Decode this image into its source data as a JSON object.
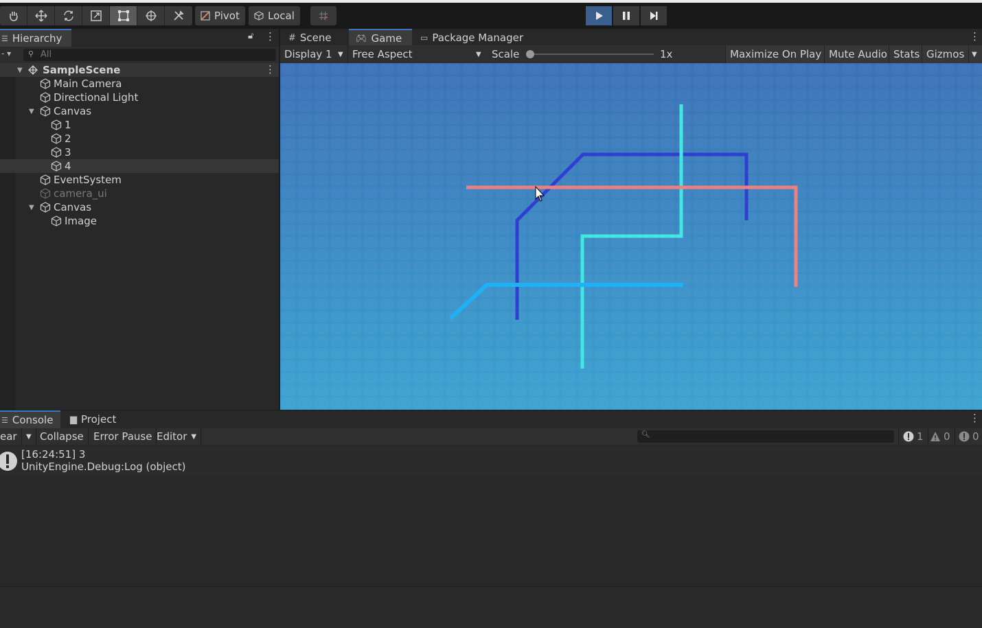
{
  "toolbar": {
    "tools": [
      "hand-icon",
      "move-icon",
      "rotate-icon",
      "scale-icon",
      "rect-icon",
      "transform-icon",
      "custom-tool-icon"
    ],
    "pivot_label": "Pivot",
    "local_label": "Local",
    "play_controls": [
      "play-icon",
      "pause-icon",
      "step-icon"
    ]
  },
  "hierarchy": {
    "tab_label": "Hierarchy",
    "search_placeholder": "All",
    "scene_name": "SampleScene",
    "items": [
      {
        "label": "Main Camera",
        "depth": 1,
        "expand": ""
      },
      {
        "label": "Directional Light",
        "depth": 1,
        "expand": ""
      },
      {
        "label": "Canvas",
        "depth": 1,
        "expand": "expanded"
      },
      {
        "label": "1",
        "depth": 2,
        "expand": ""
      },
      {
        "label": "2",
        "depth": 2,
        "expand": ""
      },
      {
        "label": "3",
        "depth": 2,
        "expand": ""
      },
      {
        "label": "4",
        "depth": 2,
        "expand": "",
        "selected": true
      },
      {
        "label": "EventSystem",
        "depth": 1,
        "expand": ""
      },
      {
        "label": "camera_ui",
        "depth": 1,
        "expand": "",
        "disabled": true
      },
      {
        "label": "Canvas",
        "depth": 1,
        "expand": "expanded"
      },
      {
        "label": "Image",
        "depth": 2,
        "expand": ""
      }
    ]
  },
  "viewtabs": {
    "scene": "Scene",
    "game": "Game",
    "package_manager": "Package Manager"
  },
  "gameview": {
    "display": "Display 1",
    "aspect": "Free Aspect",
    "scale_label": "Scale",
    "scale_value": "1x",
    "maximize": "Maximize On Play",
    "mute": "Mute Audio",
    "stats": "Stats",
    "gizmos": "Gizmos",
    "colors": {
      "line_pink": "#ef8080",
      "line_navy": "#2f3fd0",
      "line_cyan": "#40e8e0",
      "line_sky": "#20b0f5"
    }
  },
  "console": {
    "tab_console": "Console",
    "tab_project": "Project",
    "clear_label": "ear",
    "collapse_label": "Collapse",
    "error_pause_label": "Error Pause",
    "editor_label": "Editor",
    "count_info": "1",
    "count_warn": "0",
    "count_error": "0",
    "log_line1": "[16:24:51] 3",
    "log_line2": "UnityEngine.Debug:Log (object)"
  }
}
